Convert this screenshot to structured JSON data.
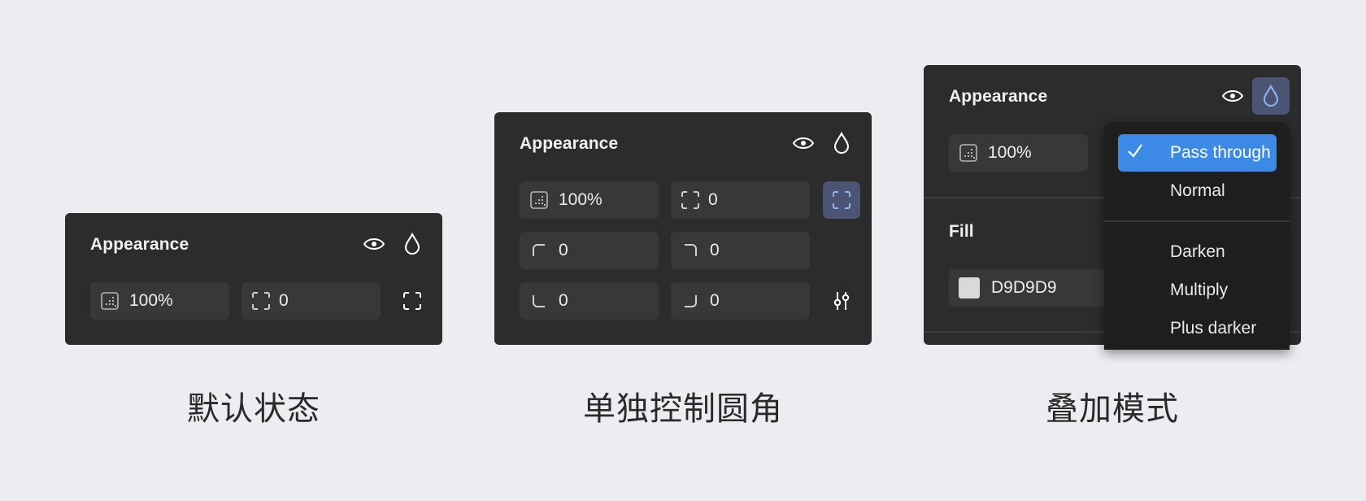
{
  "panels": {
    "default": {
      "title": "Appearance",
      "opacity": "100%",
      "radius": "0",
      "caption": "默认状态"
    },
    "corners": {
      "title": "Appearance",
      "opacity": "100%",
      "radius": "0",
      "top_left": "0",
      "top_right": "0",
      "bottom_left": "0",
      "bottom_right": "0",
      "caption": "单独控制圆角"
    },
    "blend": {
      "title": "Appearance",
      "opacity": "100%",
      "fill_title": "Fill",
      "fill_hex": "D9D9D9",
      "caption": "叠加模式"
    }
  },
  "blend_menu": {
    "selected": "Pass through",
    "items": [
      "Pass through",
      "Normal",
      "Darken",
      "Multiply",
      "Plus darker"
    ]
  },
  "icons": [
    "eye-icon",
    "drop-icon",
    "opacity-icon",
    "corner-radius-icon",
    "independent-corners-icon",
    "corner-top-left-icon",
    "corner-top-right-icon",
    "corner-bottom-left-icon",
    "corner-bottom-right-icon",
    "sliders-icon",
    "check-icon"
  ],
  "colors": {
    "page_bg": "#ecedf1",
    "panel_bg": "#2c2c2c",
    "field_bg": "#383838",
    "accent": "#3d8ae6",
    "active_button_bg": "#4b5573",
    "active_icon": "#8fb4f2",
    "swatch": "#d9d9d9"
  }
}
